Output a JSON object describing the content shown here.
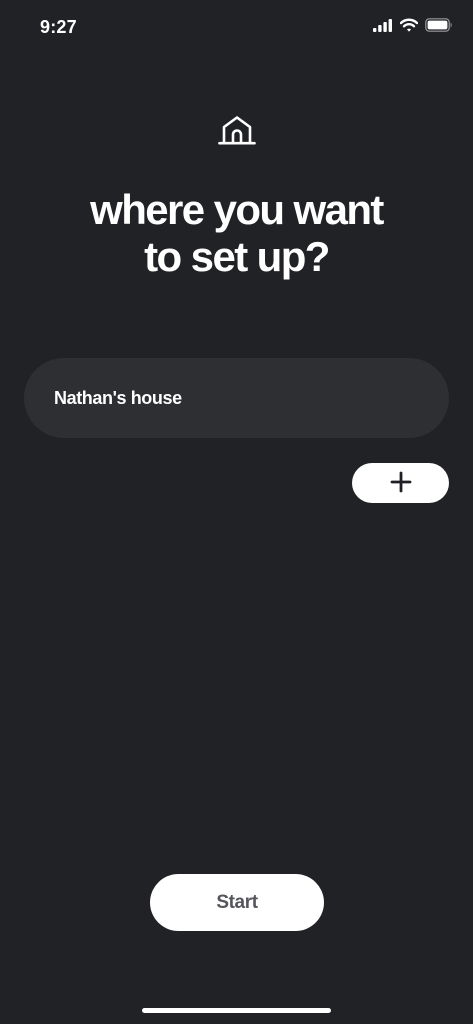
{
  "status_bar": {
    "time": "9:27",
    "icons": [
      "cellular-signal-icon",
      "wifi-icon",
      "battery-icon"
    ]
  },
  "header": {
    "icon": "home-icon",
    "title_line1": "where you want",
    "title_line2": "to set up?"
  },
  "locations": [
    {
      "label": "Nathan's house"
    }
  ],
  "actions": {
    "add_icon": "plus-icon",
    "start_label": "Start"
  },
  "colors": {
    "background": "#212226",
    "card": "#2e2f33",
    "button": "#ffffff",
    "button_text": "#55565b",
    "text": "#ffffff"
  }
}
